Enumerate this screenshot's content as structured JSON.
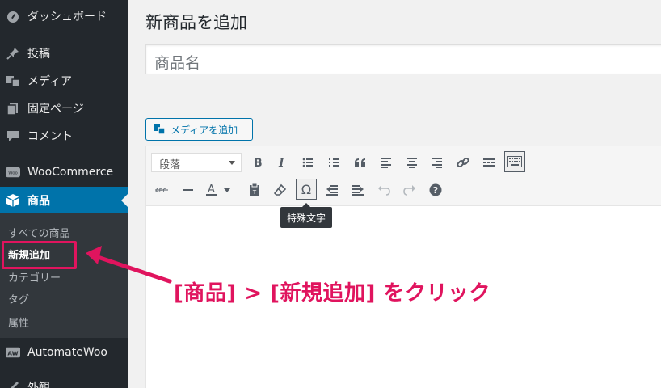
{
  "sidebar": {
    "items": [
      {
        "label": "ダッシュボード",
        "icon": "dashboard-icon"
      },
      {
        "label": "投稿",
        "icon": "pushpin-icon"
      },
      {
        "label": "メディア",
        "icon": "media-icon"
      },
      {
        "label": "固定ページ",
        "icon": "page-icon"
      },
      {
        "label": "コメント",
        "icon": "comment-icon"
      },
      {
        "label": "WooCommerce",
        "icon": "woo-icon"
      },
      {
        "label": "商品",
        "icon": "box-icon"
      },
      {
        "label": "AutomateWoo",
        "icon": "aw-icon"
      },
      {
        "label": "外観",
        "icon": "brush-icon"
      }
    ],
    "submenu": [
      {
        "label": "すべての商品"
      },
      {
        "label": "新規追加"
      },
      {
        "label": "カテゴリー"
      },
      {
        "label": "タグ"
      },
      {
        "label": "属性"
      }
    ],
    "woo_badge": "Woo",
    "aw_badge": "AW"
  },
  "main": {
    "title": "新商品を追加",
    "title_placeholder": "商品名",
    "media_button": "メディアを追加",
    "format_select": "段落",
    "tooltip": "特殊文字"
  },
  "annotation": "[商品] > [新規追加] をクリック",
  "colors": {
    "accent": "#0073aa",
    "sidebar": "#23282d",
    "annotation": "#e0145e"
  }
}
